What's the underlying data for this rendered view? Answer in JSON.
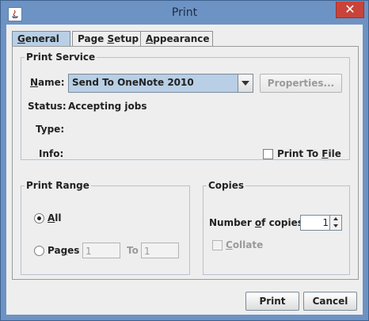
{
  "window": {
    "title": "Print",
    "close_glyph": "✕"
  },
  "tabs": [
    {
      "label_pre": "",
      "mnemonic": "G",
      "label_post": "eneral",
      "active": true
    },
    {
      "label_pre": "Page ",
      "mnemonic": "S",
      "label_post": "etup",
      "active": false
    },
    {
      "label_pre": "",
      "mnemonic": "A",
      "label_post": "ppearance",
      "active": false
    }
  ],
  "print_service": {
    "legend": "Print Service",
    "name_label_mn": "N",
    "name_label_rest": "ame:",
    "name_value": "Send To OneNote 2010",
    "properties_button": "Properties...",
    "status_label": "Status:",
    "status_value": "Accepting jobs",
    "type_label": "Type:",
    "info_label": "Info:",
    "print_to_file_pre": "Print To ",
    "print_to_file_mn": "F",
    "print_to_file_post": "ile"
  },
  "print_range": {
    "legend": "Print Range",
    "all_mn": "A",
    "all_rest": "ll",
    "pages_pre": "Pa",
    "pages_mn": "g",
    "pages_post": "es",
    "from_value": "1",
    "to_label": "To",
    "to_value": "1"
  },
  "copies": {
    "legend": "Copies",
    "number_pre": "Number ",
    "number_mn": "o",
    "number_post": "f copies:",
    "copies_value": "1",
    "collate_mn": "C",
    "collate_rest": "ollate"
  },
  "footer": {
    "print_button": "Print",
    "cancel_button": "Cancel"
  },
  "colors": {
    "window_frame": "#6d93c4",
    "close_button": "#c8443a",
    "selected_accent": "#b8cfe5"
  }
}
